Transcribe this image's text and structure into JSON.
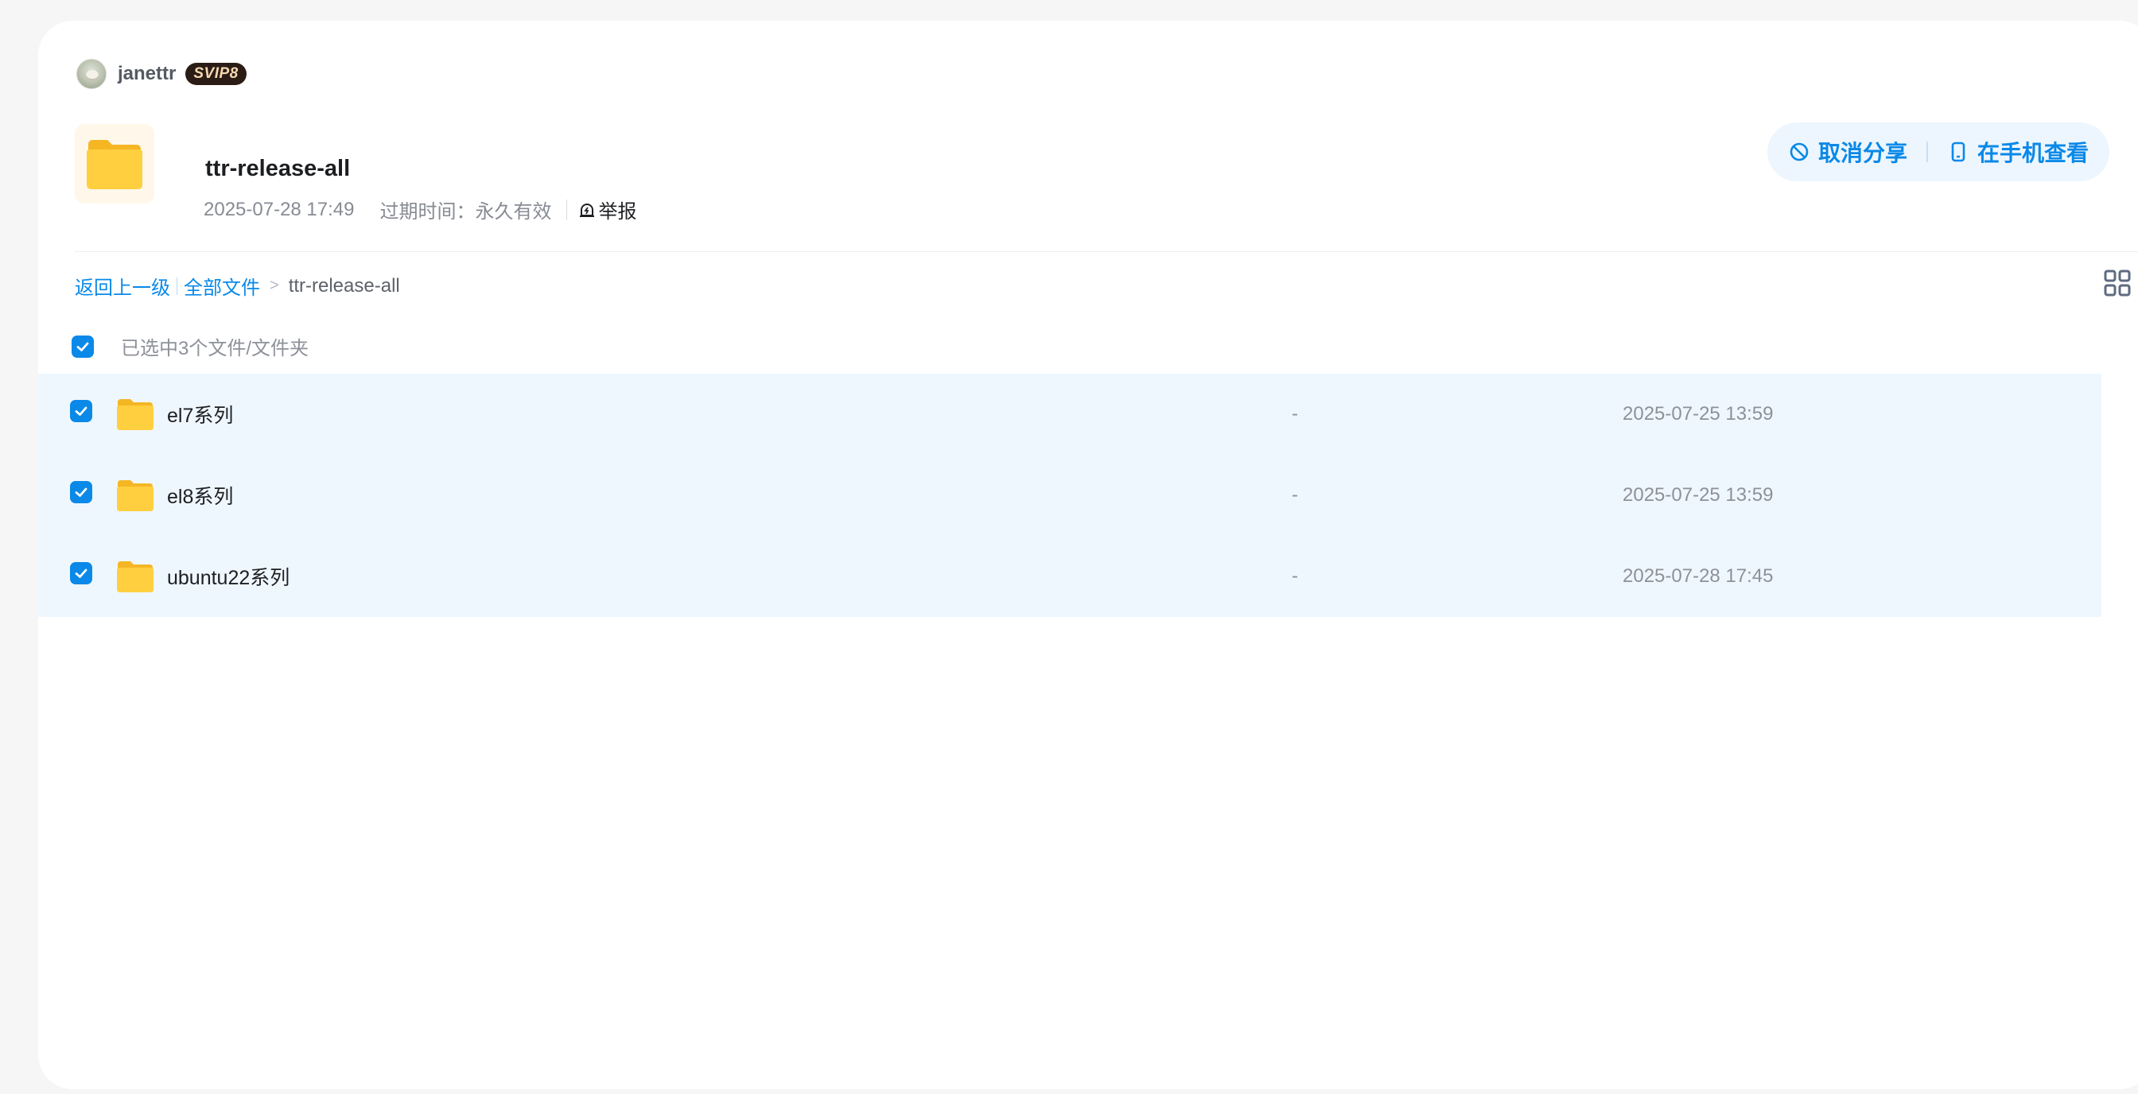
{
  "user": {
    "name": "janettr",
    "badge": "SVIP8"
  },
  "share": {
    "title": "ttr-release-all",
    "created": "2025-07-28 17:49",
    "expiry_label": "过期时间：",
    "expiry_value": "永久有效",
    "report_label": "举报"
  },
  "actions": {
    "cancel_share": "取消分享",
    "view_on_phone": "在手机查看"
  },
  "breadcrumb": {
    "back": "返回上一级",
    "all_files": "全部文件",
    "separator": ">",
    "current": "ttr-release-all"
  },
  "selection": {
    "text": "已选中3个文件/文件夹",
    "all_checked": true
  },
  "files": [
    {
      "name": "el7系列",
      "size": "-",
      "date": "2025-07-25 13:59",
      "checked": true
    },
    {
      "name": "el8系列",
      "size": "-",
      "date": "2025-07-25 13:59",
      "checked": true
    },
    {
      "name": "ubuntu22系列",
      "size": "-",
      "date": "2025-07-28 17:45",
      "checked": true
    }
  ],
  "colors": {
    "accent": "#0a89e8",
    "selected_row": "#eff7fe",
    "folder": "#ffc93a"
  },
  "icons": [
    "avatar",
    "folder-icon",
    "report-icon",
    "cancel-share-icon",
    "phone-icon",
    "grid-view-icon",
    "checkbox-checked-icon"
  ]
}
